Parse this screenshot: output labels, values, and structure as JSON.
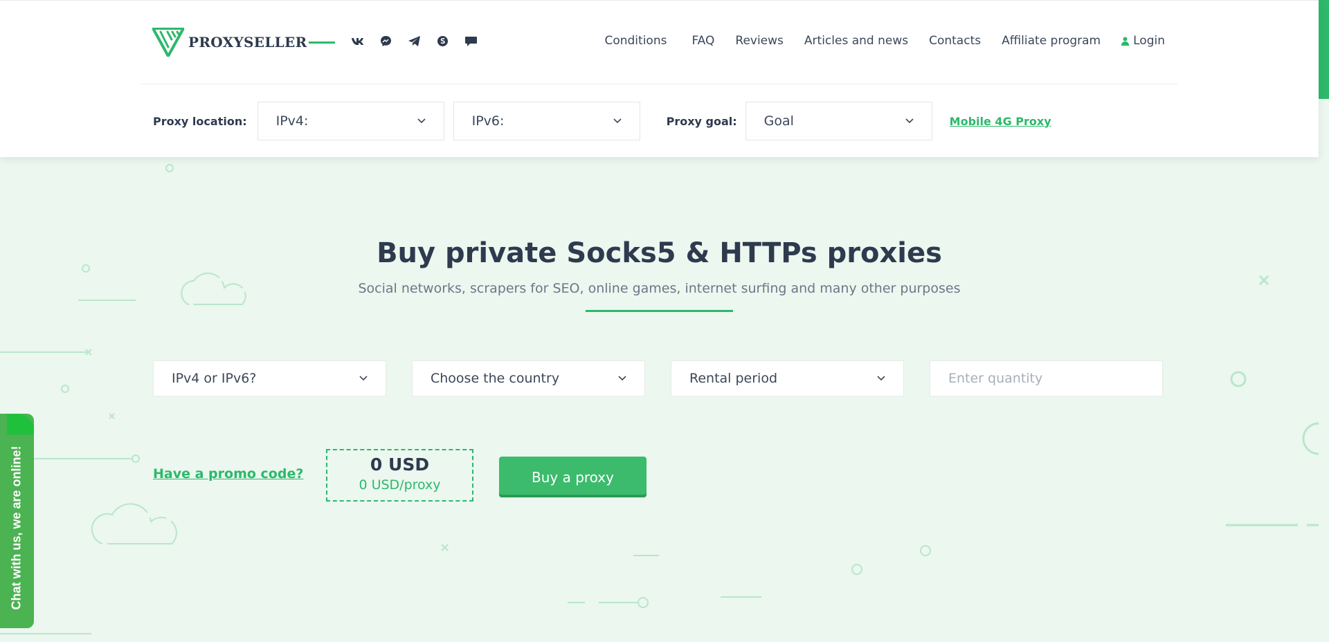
{
  "header": {
    "logo_text": "PROXYSELLER",
    "socials": [
      {
        "name": "vk-icon"
      },
      {
        "name": "messenger-icon"
      },
      {
        "name": "telegram-icon"
      },
      {
        "name": "skype-icon"
      },
      {
        "name": "chat-icon"
      }
    ],
    "nav": {
      "conditions": "Conditions",
      "faq": "FAQ",
      "reviews": "Reviews",
      "articles": "Articles and news",
      "contacts": "Contacts",
      "affiliate": "Affiliate program",
      "login": "Login"
    },
    "filters": {
      "location_label": "Proxy location:",
      "ipv4_value": "IPv4:",
      "ipv6_value": "IPv6:",
      "goal_label": "Proxy goal:",
      "goal_value": "Goal",
      "mobile_link": "Mobile 4G Proxy"
    }
  },
  "hero": {
    "title": "Buy private Socks5 & HTTPs proxies",
    "subtitle": "Social networks, scrapers for SEO, online games, internet surfing and many other purposes"
  },
  "order": {
    "protocol_value": "IPv4 or IPv6?",
    "country_value": "Choose the country",
    "period_value": "Rental period",
    "quantity_placeholder": "Enter quantity",
    "promo_link": "Have a promo code?",
    "total": "0 USD",
    "per_proxy": "0 USD/proxy",
    "buy_label": "Buy a proxy"
  },
  "chat": {
    "label": "Chat with us, we are online!"
  },
  "colors": {
    "accent": "#2db86b",
    "background": "#ebf7ef",
    "text": "#2e3a4d",
    "chat": "#4bb351"
  }
}
